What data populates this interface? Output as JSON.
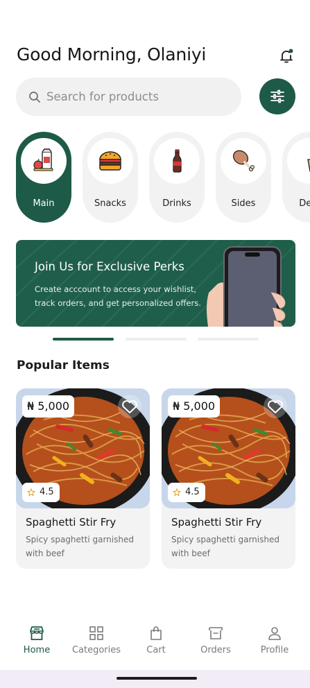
{
  "header": {
    "greeting": "Good Morning, Olaniyi"
  },
  "search": {
    "placeholder": "Search for products"
  },
  "categories": [
    {
      "label": "Main",
      "icon": "grocery-icon",
      "active": true
    },
    {
      "label": "Snacks",
      "icon": "burger-icon",
      "active": false
    },
    {
      "label": "Drinks",
      "icon": "bottle-icon",
      "active": false
    },
    {
      "label": "Sides",
      "icon": "chicken-leg-icon",
      "active": false
    },
    {
      "label": "Dess",
      "icon": "dessert-icon",
      "active": false
    }
  ],
  "banner": {
    "title": "Join Us for Exclusive Perks",
    "body": "Create acccount to access your wishlist, track orders, and get personalized offers."
  },
  "carousel": {
    "total": 3,
    "active": 1
  },
  "popular": {
    "title": "Popular Items",
    "items": [
      {
        "price": "₦ 5,000",
        "rating": "4.5",
        "name": "Spaghetti Stir Fry",
        "description": "Spicy spaghetti garnished with beef"
      },
      {
        "price": "₦ 5,000",
        "rating": "4.5",
        "name": "Spaghetti Stir Fry",
        "description": "Spicy spaghetti garnished with beef"
      }
    ]
  },
  "tabbar": {
    "items": [
      {
        "label": "Home",
        "icon": "store-icon",
        "active": true
      },
      {
        "label": "Categories",
        "icon": "grid-icon",
        "active": false
      },
      {
        "label": "Cart",
        "icon": "bag-icon",
        "active": false
      },
      {
        "label": "Orders",
        "icon": "archive-icon",
        "active": false
      },
      {
        "label": "Profile",
        "icon": "user-icon",
        "active": false
      }
    ]
  },
  "colors": {
    "brand": "#1e5a48",
    "surface": "#f2f2f2"
  }
}
